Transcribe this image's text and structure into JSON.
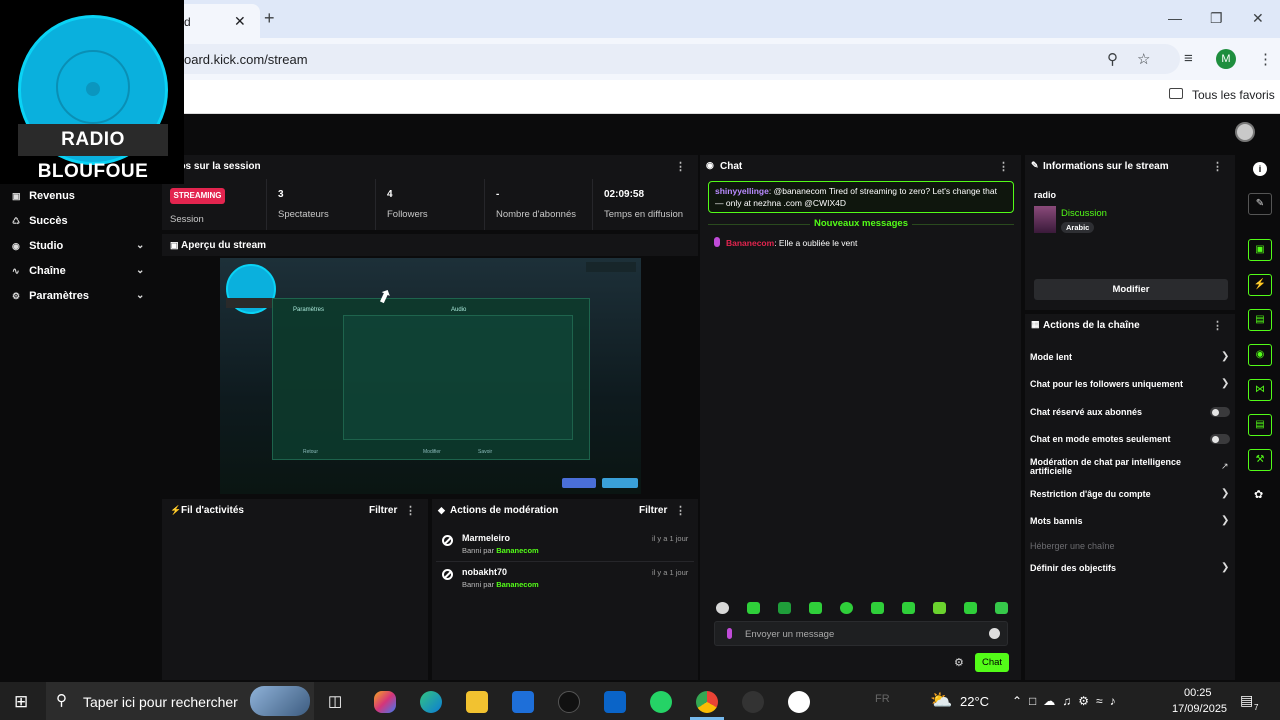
{
  "browser": {
    "tab_title": "d",
    "tab_close": "✕",
    "new_tab": "+",
    "url": "oard.kick.com/stream",
    "bookmarks_all": "Tous les favoris",
    "profile_initial": "M"
  },
  "overlay_logo": {
    "text": "RADIO BLOUFOUE"
  },
  "sidebar": {
    "items": [
      {
        "label": "Revenus",
        "has_chevron": false
      },
      {
        "label": "Succès",
        "has_chevron": false
      },
      {
        "label": "Studio",
        "has_chevron": true
      },
      {
        "label": "Chaîne",
        "has_chevron": true
      },
      {
        "label": "Paramètres",
        "has_chevron": true
      }
    ]
  },
  "session": {
    "title": "nfos sur la session",
    "badge": "STREAMING",
    "status_label": "Session",
    "stats": [
      {
        "value": "3",
        "label": "Spectateurs"
      },
      {
        "value": "4",
        "label": "Followers"
      },
      {
        "value": "-",
        "label": "Nombre d'abonnés"
      },
      {
        "value": "02:09:58",
        "label": "Temps en diffusion"
      }
    ]
  },
  "preview": {
    "title": "Aperçu du stream"
  },
  "activity": {
    "title": "Fil d'activités",
    "filter": "Filtrer"
  },
  "moderation": {
    "title": "Actions de modération",
    "filter": "Filtrer",
    "items": [
      {
        "user": "Marmeleiro",
        "action": "Banni par",
        "by": "Bananecom",
        "time": "il y a 1 jour"
      },
      {
        "user": "nobakht70",
        "action": "Banni par",
        "by": "Bananecom",
        "time": "il y a 1 jour"
      }
    ]
  },
  "chat": {
    "title": "Chat",
    "pinned": {
      "user": "shinyyellinge",
      "text": ": @bananecom Tired of streaming to zero? Let's change that — only at nezhna .com @CWIX4D"
    },
    "new_messages": "Nouveaux messages",
    "message": {
      "user": "Bananecom",
      "text": ": Elle a oubliée le vent"
    },
    "input_placeholder": "Envoyer un message",
    "send_label": "Chat"
  },
  "stream_info": {
    "title": "Informations sur le stream",
    "stream_title": "radio",
    "category": "Discussion",
    "language": "Arabic",
    "edit_button": "Modifier"
  },
  "channel_actions": {
    "title": "Actions de la chaîne",
    "items": [
      {
        "label": "Mode lent",
        "control": "chevron"
      },
      {
        "label": "Chat pour les followers uniquement",
        "control": "chevron"
      },
      {
        "label": "Chat réservé aux abonnés",
        "control": "toggle"
      },
      {
        "label": "Chat en mode emotes seulement",
        "control": "toggle"
      },
      {
        "label": "Modération de chat par intelligence artificielle",
        "control": "external"
      },
      {
        "label": "Restriction d'âge du compte",
        "control": "chevron"
      },
      {
        "label": "Mots bannis",
        "control": "chevron"
      },
      {
        "label": "Héberger une chaîne",
        "control": "none",
        "disabled": true
      },
      {
        "label": "Définir des objectifs",
        "control": "chevron"
      }
    ]
  },
  "preview_content": {
    "header_left": "Paramètres",
    "header_right": "Audio",
    "buttons": [
      "Retour",
      "Modifier",
      "Savoir"
    ]
  },
  "taskbar": {
    "search_placeholder": "Taper ici pour rechercher",
    "lang": "FR",
    "temperature": "22°C",
    "time": "00:25",
    "date": "17/09/2025",
    "notifications": "7"
  },
  "colors": {
    "accent": "#53fc18",
    "streaming_badge": "#e3254f",
    "panel_bg": "#141416",
    "page_bg": "#0b0b0c"
  }
}
